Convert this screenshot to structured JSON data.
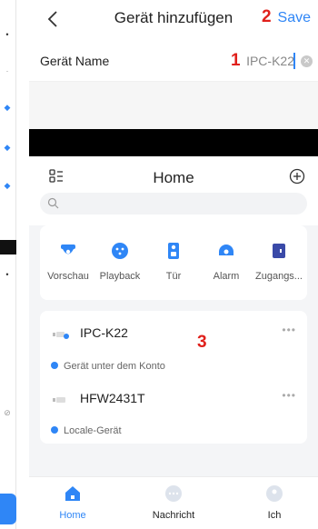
{
  "header": {
    "title": "Gerät hinzufügen",
    "save_label": "Save"
  },
  "device_name_row": {
    "label": "Gerät Name",
    "value": "IPC-K22"
  },
  "markers": {
    "m1": "1",
    "m2": "2",
    "m3": "3"
  },
  "home": {
    "title": "Home",
    "search_placeholder": "",
    "quick_actions": [
      {
        "label": "Vorschau",
        "icon": "camera-icon"
      },
      {
        "label": "Playback",
        "icon": "playback-icon"
      },
      {
        "label": "Tür",
        "icon": "door-icon"
      },
      {
        "label": "Alarm",
        "icon": "alarm-icon"
      },
      {
        "label": "Zugangs...",
        "icon": "access-icon"
      }
    ],
    "devices": [
      {
        "name": "IPC-K22",
        "subtitle": "Gerät unter dem Konto"
      },
      {
        "name": "HFW2431T",
        "subtitle": "Locale-Gerät"
      }
    ],
    "tabs": [
      {
        "label": "Home",
        "icon": "home-icon"
      },
      {
        "label": "Nachricht",
        "icon": "message-icon"
      },
      {
        "label": "Ich",
        "icon": "profile-icon"
      }
    ]
  },
  "colors": {
    "accent": "#2f86f6",
    "marker": "#e0201b",
    "background": "#f4f5f7"
  }
}
